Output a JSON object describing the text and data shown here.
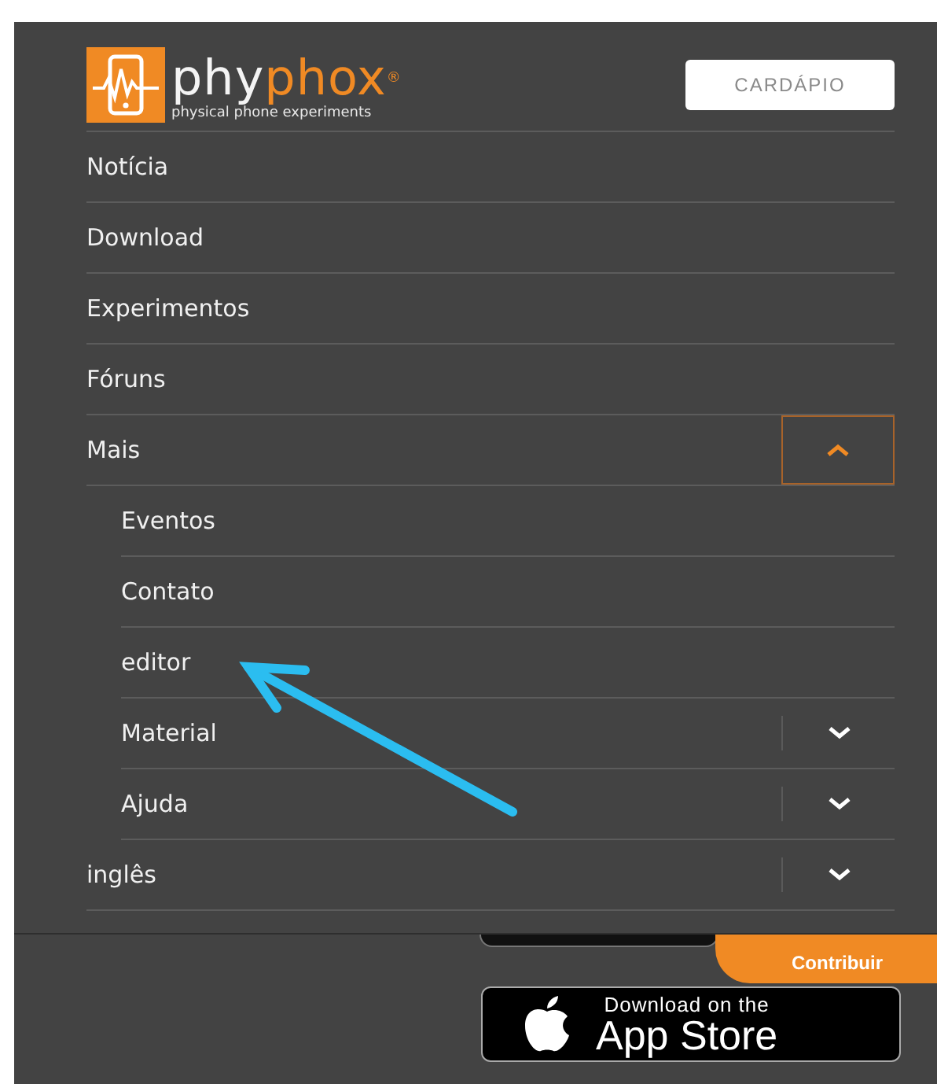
{
  "header": {
    "logo": {
      "name_start": "phy",
      "name_end": "phox",
      "registered": "®",
      "tagline": "physical phone experiments"
    },
    "menu_button": "CARDÁPIO"
  },
  "menu": [
    {
      "label": "Notícia",
      "kind": "link"
    },
    {
      "label": "Download",
      "kind": "link"
    },
    {
      "label": "Experimentos",
      "kind": "link"
    },
    {
      "label": "Fóruns",
      "kind": "link"
    },
    {
      "label": "Mais",
      "kind": "dropdown",
      "expanded": true,
      "children": [
        {
          "label": "Eventos",
          "kind": "link"
        },
        {
          "label": "Contato",
          "kind": "link"
        },
        {
          "label": "editor",
          "kind": "link"
        },
        {
          "label": "Material",
          "kind": "dropdown",
          "expanded": false
        },
        {
          "label": "Ajuda",
          "kind": "dropdown",
          "expanded": false
        }
      ]
    },
    {
      "label": "inglês",
      "kind": "dropdown",
      "expanded": false
    }
  ],
  "contribute_tab": "Contribuir",
  "app_store_badge": {
    "small": "Download on the",
    "large": "App Store"
  }
}
